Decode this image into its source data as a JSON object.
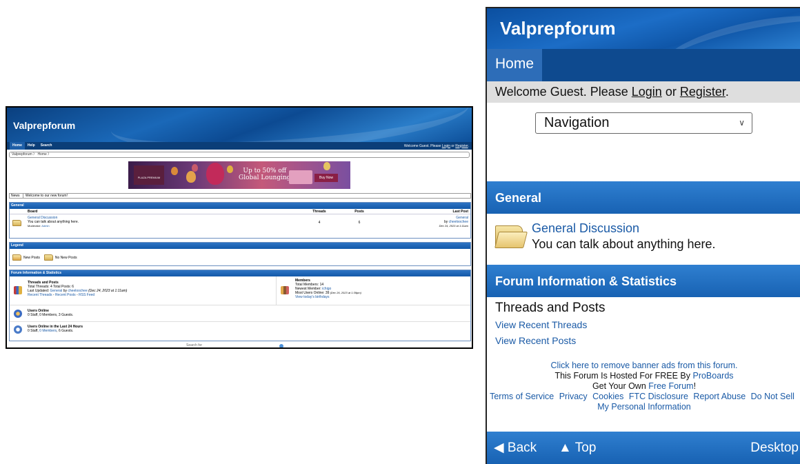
{
  "desktop": {
    "title": "Valprepforum",
    "nav": [
      "Home",
      "Help",
      "Search"
    ],
    "welcome_prefix": "Welcome Guest. Please ",
    "login": "Login",
    "or": " or ",
    "register": "Register",
    "welcome_suffix": ".",
    "breadcrumb": [
      "Valprepforum",
      "Home"
    ],
    "ad": {
      "brand": "PLAZA PREMIUM",
      "text_line1": "Up to 50% off",
      "text_line2": "Global Lounging",
      "button": "Buy Now"
    },
    "news_label": "News",
    "news_text": "Welcome to our new forum!",
    "general": {
      "header": "General",
      "columns": [
        "Board",
        "Threads",
        "Posts",
        "Last Post"
      ],
      "board": {
        "name": "General Discussion",
        "description": "You can talk about anything here.",
        "moderator_label": "Moderator: ",
        "moderator": "Admin",
        "threads": "4",
        "posts": "6",
        "last_post_board": "General",
        "last_post_by": "by ",
        "last_post_user": "cheeloochee",
        "last_post_date": "Dec 24, 2023 at 1:11am"
      }
    },
    "legend": {
      "header": "Legend",
      "new_posts": "New Posts",
      "no_new_posts": "No New Posts"
    },
    "stats": {
      "header": "Forum Information & Statistics",
      "threads_title": "Threads and Posts",
      "totals": "Total Threads: 4    Total Posts: 6",
      "last_updated_prefix": "Last Updated: ",
      "last_updated_board": "General",
      "last_updated_by": " by ",
      "last_updated_user": "cheeloochee",
      "last_updated_date": " (Dec 24, 2023 at 1:11am)",
      "recent_threads": "Recent Threads",
      "recent_posts": "Recent Posts",
      "rss": "RSS Feed",
      "sep": " - ",
      "members_title": "Members",
      "total_members": "Total Members: 14",
      "newest_prefix": "Newest Member: ",
      "newest_member": "ichigo",
      "most_online": "Most Users Online: 39",
      "most_online_date": " (Dec 26, 2023 at 1:39pm)",
      "birthdays": "View today's birthdays",
      "online_title": "Users Online",
      "online_text": "0 Staff, 0 Members, 3 Guests.",
      "last24_title": "Users Online in the Last 24 Hours",
      "last24_prefix": "0 Staff, ",
      "last24_members": "0 Members",
      "last24_suffix": ", 6 Guests."
    },
    "search_label": "Search for"
  },
  "mobile": {
    "title": "Valprepforum",
    "tab_home": "Home",
    "welcome_prefix": "Welcome Guest. Please ",
    "login": "Login",
    "or": " or ",
    "register": "Register",
    "welcome_suffix": ".",
    "navigation_select": "Navigation",
    "general_header": "General",
    "board_name": "General Discussion",
    "board_description": "You can talk about anything here.",
    "stats_header": "Forum Information & Statistics",
    "threads_posts": "Threads and Posts",
    "view_recent_threads": "View Recent Threads",
    "view_recent_posts": "View Recent Posts",
    "footer": {
      "remove_ads": "Click here to remove banner ads from this forum.",
      "hosted_prefix": "This Forum Is Hosted For FREE By ",
      "proboards": "ProBoards",
      "get_own_prefix": "Get Your Own ",
      "free_forum": "Free Forum",
      "get_own_suffix": "!",
      "links": [
        "Terms of Service",
        "Privacy",
        "Cookies",
        "FTC Disclosure",
        "Report Abuse",
        "Do Not Sell",
        "My Personal Information"
      ]
    },
    "bottom": {
      "back": "Back",
      "top": "Top",
      "desktop": "Desktop"
    }
  },
  "colors": {
    "header_blue": "#1862b3",
    "nav_dark": "#0e4a8f",
    "link": "#1a5aa6",
    "welcome_bg": "#dedede"
  }
}
